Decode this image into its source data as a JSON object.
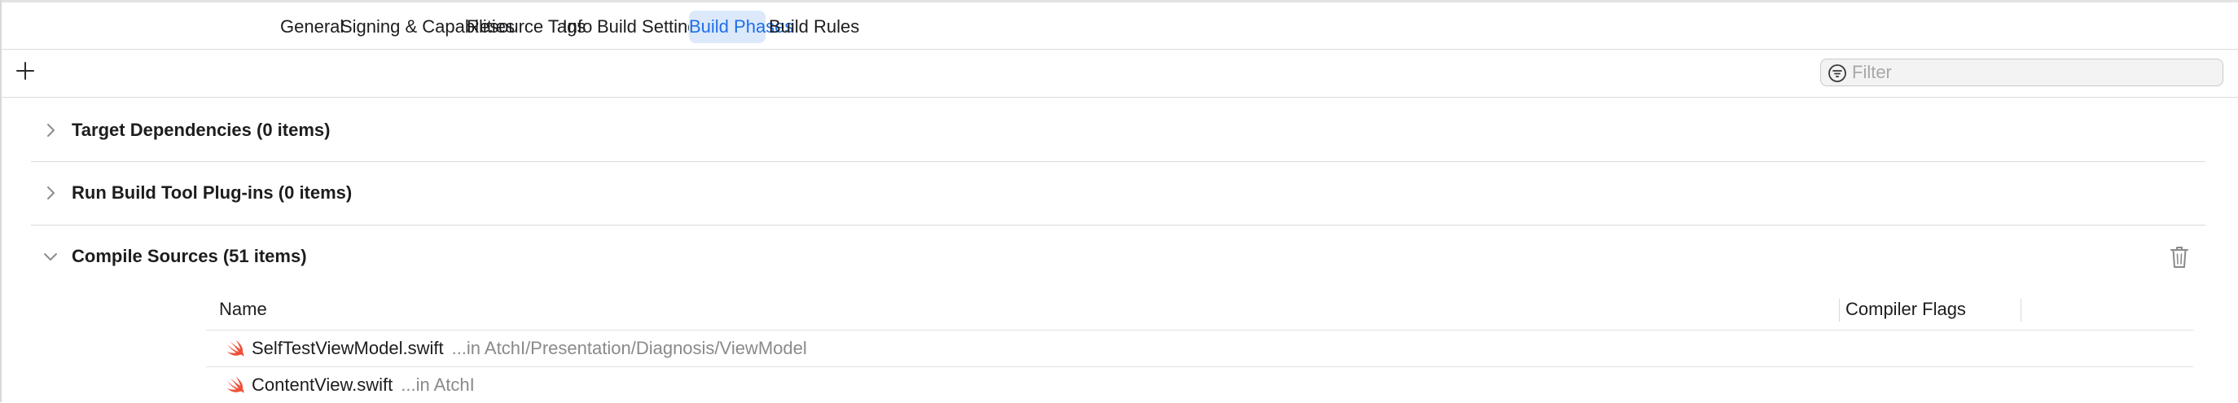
{
  "tabs": [
    {
      "label": "General",
      "active": false
    },
    {
      "label": "Signing & Capabilities",
      "active": false
    },
    {
      "label": "Resource Tags",
      "active": false
    },
    {
      "label": "Info",
      "active": false
    },
    {
      "label": "Build Settings",
      "active": false
    },
    {
      "label": "Build Phases",
      "active": true
    },
    {
      "label": "Build Rules",
      "active": false
    }
  ],
  "toolbar": {
    "add_icon": "plus-icon",
    "filter_icon": "filter-circle-icon",
    "filter_placeholder": "Filter",
    "filter_value": ""
  },
  "phases": [
    {
      "title": "Target Dependencies (0 items)",
      "expanded": false
    },
    {
      "title": "Run Build Tool Plug-ins (0 items)",
      "expanded": false
    },
    {
      "title": "Compile Sources (51 items)",
      "expanded": true,
      "delete_icon": "trash-icon"
    }
  ],
  "compile_sources": {
    "columns": [
      "Name",
      "Compiler Flags"
    ],
    "rows": [
      {
        "icon": "swift-file-icon",
        "name": "SelfTestViewModel.swift",
        "location": "...in AtchI/Presentation/Diagnosis/ViewModel",
        "flags": ""
      },
      {
        "icon": "swift-file-icon",
        "name": "ContentView.swift",
        "location": "...in AtchI",
        "flags": ""
      }
    ]
  },
  "colors": {
    "accent": "#1e6fe6",
    "active_tab_bg": "#dce9fb",
    "swift_orange": "#f05138",
    "secondary_text": "#8a8a8a"
  }
}
